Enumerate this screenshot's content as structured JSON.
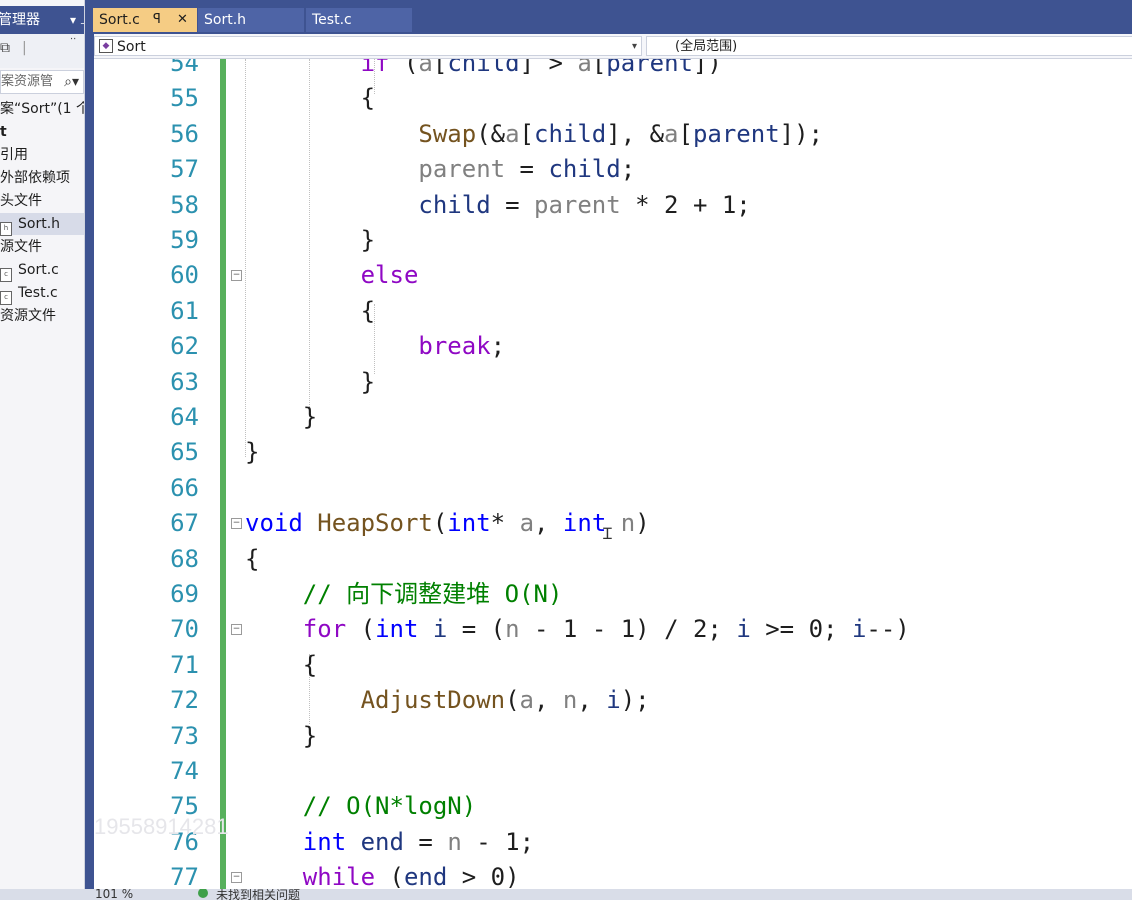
{
  "solution_explorer": {
    "title": "管理器",
    "pin_glyph": "▾ ⊥",
    "search_placeholder": "案资源管",
    "items": [
      {
        "label": "案“Sort”(1 个"
      },
      {
        "label": "t"
      },
      {
        "label": "引用"
      },
      {
        "label": "外部依赖项"
      },
      {
        "label": "头文件"
      },
      {
        "label": "Sort.h"
      },
      {
        "label": "源文件"
      },
      {
        "label": "Sort.c"
      },
      {
        "label": "Test.c"
      },
      {
        "label": "资源文件"
      }
    ]
  },
  "tabs": [
    {
      "label": "Sort.c",
      "pin": "ꟼ",
      "close": "✕"
    },
    {
      "label": "Sort.h"
    },
    {
      "label": "Test.c"
    }
  ],
  "nav": {
    "project": "Sort",
    "scope": "(全局范围)"
  },
  "code_lines": [
    {
      "n": "54",
      "html": "        <span class=\"ctrl\">if</span> (<span class=\"prm\">a</span>[<span class=\"var\">child</span>] &gt; <span class=\"prm\">a</span>[<span class=\"var\">parent</span>])"
    },
    {
      "n": "55",
      "html": "        {"
    },
    {
      "n": "56",
      "html": "            <span class=\"fn\">Swap</span>(&amp;<span class=\"prm\">a</span>[<span class=\"var\">child</span>], &amp;<span class=\"prm\">a</span>[<span class=\"var\">parent</span>]);"
    },
    {
      "n": "57",
      "html": "            <span class=\"prm\">parent</span> = <span class=\"var\">child</span>;"
    },
    {
      "n": "58",
      "html": "            <span class=\"var\">child</span> = <span class=\"prm\">parent</span> * 2 + 1;"
    },
    {
      "n": "59",
      "html": "        }"
    },
    {
      "n": "60",
      "html": "        <span class=\"ctrl\">else</span>",
      "fold": true
    },
    {
      "n": "61",
      "html": "        {"
    },
    {
      "n": "62",
      "html": "            <span class=\"ctrl\">break</span>;"
    },
    {
      "n": "63",
      "html": "        }"
    },
    {
      "n": "64",
      "html": "    }"
    },
    {
      "n": "65",
      "html": "}"
    },
    {
      "n": "66",
      "html": ""
    },
    {
      "n": "67",
      "html": "<span class=\"kw\">void</span> <span class=\"fn\">HeapSort</span>(<span class=\"kw\">int</span>* <span class=\"prm\">a</span>, <span class=\"kw\">int</span> <span class=\"prm\">n</span>)",
      "fold": true
    },
    {
      "n": "68",
      "html": "{"
    },
    {
      "n": "69",
      "html": "    <span class=\"cmt\">// 向下调整建堆 O(N)</span>"
    },
    {
      "n": "70",
      "html": "    <span class=\"ctrl\">for</span> (<span class=\"kw\">int</span> <span class=\"var\">i</span> = (<span class=\"prm\">n</span> - 1 - 1) / 2; <span class=\"var\">i</span> &gt;= 0; <span class=\"var\">i</span>--)",
      "fold": true
    },
    {
      "n": "71",
      "html": "    {"
    },
    {
      "n": "72",
      "html": "        <span class=\"fn\">AdjustDown</span>(<span class=\"prm\">a</span>, <span class=\"prm\">n</span>, <span class=\"var\">i</span>);"
    },
    {
      "n": "73",
      "html": "    }"
    },
    {
      "n": "74",
      "html": ""
    },
    {
      "n": "75",
      "html": "    <span class=\"cmt\">// O(N*logN)</span>"
    },
    {
      "n": "76",
      "html": "    <span class=\"kw\">int</span> <span class=\"var\">end</span> = <span class=\"prm\">n</span> - 1;"
    },
    {
      "n": "77",
      "html": "    <span class=\"ctrl\">while</span> (<span class=\"var\">end</span> &gt; 0)",
      "fold": true
    }
  ],
  "watermark": "19558914281",
  "status": {
    "zoom": "101 %",
    "message": "未找到相关问题"
  }
}
